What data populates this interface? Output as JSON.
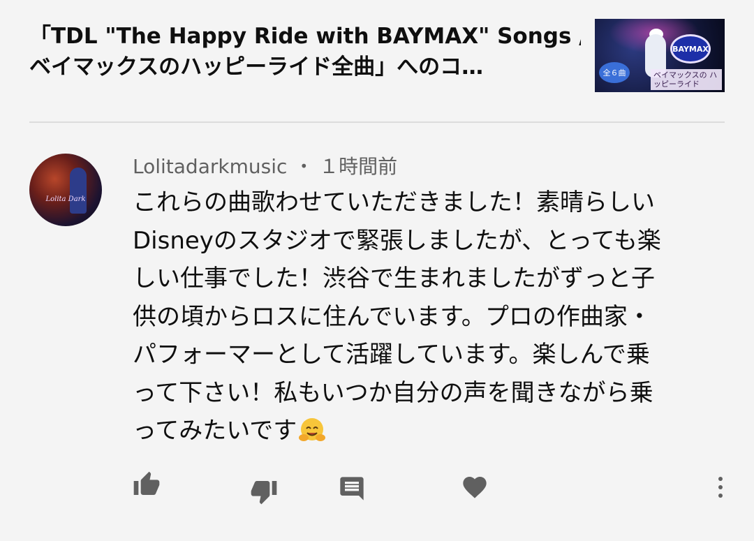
{
  "header": {
    "title_line1": "「TDL \"The Happy Ride with BAYMAX\" Songs /",
    "title_line2": "ベイマックスのハッピーライド全曲」へのコ…",
    "thumbnail": {
      "badge": "全６曲",
      "logo": "BAYMAX",
      "caption": "ベイマックスの ハッピーライド"
    }
  },
  "comment": {
    "author": "Lolitadarkmusic",
    "separator": "•",
    "time": "１時間前",
    "avatar_text": "Lolita Dark",
    "lines": [
      "これらの曲歌わせていただきました！素晴らしい",
      "Disneyのスタジオで緊張しましたが、とっても楽",
      "しい仕事でした！渋谷で生まれましたがずっと子",
      "供の頃からロスに住んでいます。プロの作曲家・",
      "パフォーマーとして活躍しています。楽しんで乗",
      "って下さい！私もいつか自分の声を聞きながら乗",
      "ってみたいです"
    ],
    "emoji": "hugging-face"
  },
  "actions": {
    "like": "thumbs-up-icon",
    "dislike": "thumbs-down-icon",
    "reply": "reply-comment-icon",
    "heart": "heart-icon",
    "more": "more-vertical-icon"
  },
  "colors": {
    "background": "#f4f4f4",
    "text_primary": "#0f0f0f",
    "text_secondary": "#606060",
    "icon": "#606060",
    "divider": "#dcdcdc"
  }
}
